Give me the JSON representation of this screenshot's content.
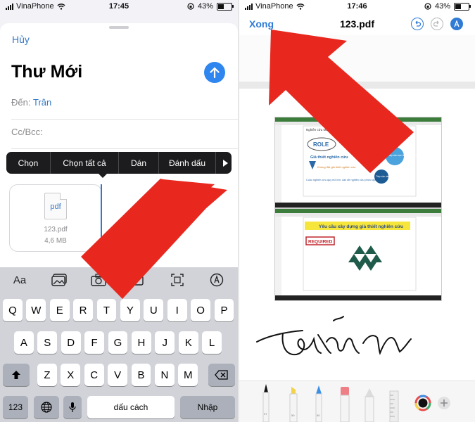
{
  "left": {
    "status": {
      "carrier": "VinaPhone",
      "time": "17:45",
      "battery": "43%"
    },
    "compose": {
      "cancel": "Hủy",
      "title": "Thư Mới",
      "to_label": "Đến:",
      "to_value": "Trân",
      "cc_label": "Cc/Bcc:"
    },
    "context_menu": [
      "Chọn",
      "Chọn tất cả",
      "Dán",
      "Đánh dấu"
    ],
    "attachment": {
      "type": "pdf",
      "name": "123.pdf",
      "size": "4,6 MB"
    },
    "keyboard": {
      "toolbar": [
        "Aa",
        "photo-library-icon",
        "camera-icon",
        "document-scan-icon",
        "scan-text-icon",
        "markup-icon"
      ],
      "row1": [
        "Q",
        "W",
        "E",
        "R",
        "T",
        "Y",
        "U",
        "I",
        "O",
        "P"
      ],
      "row2": [
        "A",
        "S",
        "D",
        "F",
        "G",
        "H",
        "J",
        "K",
        "L"
      ],
      "row3": [
        "Z",
        "X",
        "C",
        "V",
        "B",
        "N",
        "M"
      ],
      "numbers": "123",
      "space": "dấu cách",
      "return": "Nhập"
    }
  },
  "right": {
    "status": {
      "carrier": "VinaPhone",
      "time": "17:46",
      "battery": "43%"
    },
    "header": {
      "done": "Xong",
      "filename": "123.pdf"
    },
    "signature": "Trân",
    "slides": {
      "slide1_title": "Nghiên cứu Marketing",
      "slide1_hypothesis": "Giả thiết nghiên cứu",
      "slide1_no_hypothesis": "Không đặt giả thiết nghiên cứu",
      "slide1_footer": "Cuộc nghiên cứu quy mô lớn, cần đề nghiên cứu phức tạp",
      "slide1_core": "Khái niệm đúng đã sử dụng",
      "slide1_side": "Tiếp cận trực tiếp nghiên cứu chính xác",
      "slide1_side2": "Tiếp cận cần đối phó khoa học",
      "slide2_banner": "Yêu cầu xây dựng giả thiết nghiên cứu",
      "slide2_required": "REQUIRED"
    },
    "tool_colors": [
      "#111111",
      "#f2d34a",
      "#3a8ee6",
      "#ef7f86",
      "#cccccc"
    ]
  }
}
